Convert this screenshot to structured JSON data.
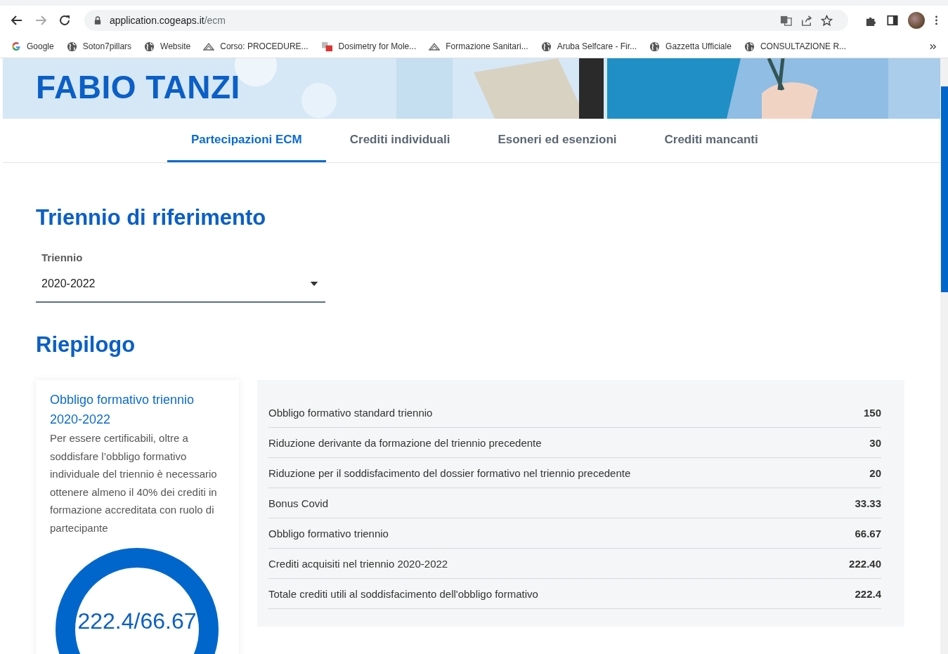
{
  "browser": {
    "url_host": "application.cogeaps.it",
    "url_path": "/ecm",
    "bookmarks": [
      {
        "label": "Google",
        "kind": "google"
      },
      {
        "label": "Soton7pillars",
        "kind": "globe"
      },
      {
        "label": "Website",
        "kind": "globe"
      },
      {
        "label": "Corso: PROCEDURE...",
        "kind": "crest"
      },
      {
        "label": "Dosimetry for Mole...",
        "kind": "squares"
      },
      {
        "label": "Formazione Sanitari...",
        "kind": "crest"
      },
      {
        "label": "Aruba Selfcare - Fir...",
        "kind": "globe"
      },
      {
        "label": "Gazzetta Ufficiale",
        "kind": "globe"
      },
      {
        "label": "CONSULTAZIONE R...",
        "kind": "globe"
      }
    ]
  },
  "hero": {
    "name": "FABIO TANZI"
  },
  "tabs": [
    {
      "label": "Partecipazioni ECM",
      "selected": true
    },
    {
      "label": "Crediti individuali",
      "selected": false
    },
    {
      "label": "Esoneri ed esenzioni",
      "selected": false
    },
    {
      "label": "Crediti mancanti",
      "selected": false
    }
  ],
  "triennio_section": {
    "heading": "Triennio di riferimento",
    "select": {
      "label": "Triennio",
      "value": "2020-2022"
    }
  },
  "riepilogo": {
    "heading": "Riepilogo",
    "card": {
      "title": "Obbligo formativo triennio 2020-2022",
      "text": "Per essere certificabili, oltre a soddisfare l’obbligo formativo individuale del triennio è necessario ottenere almeno il 40% dei crediti in formazione accreditata con ruolo di partecipante",
      "gauge_label": "222.4/66.67"
    },
    "rows": [
      {
        "label": "Obbligo formativo standard triennio",
        "value": "150"
      },
      {
        "label": "Riduzione derivante da formazione del triennio precedente",
        "value": "30"
      },
      {
        "label": "Riduzione per il soddisfacimento del dossier formativo nel triennio precedente",
        "value": "20"
      },
      {
        "label": "Bonus Covid",
        "value": "33.33"
      },
      {
        "label": "Obbligo formativo triennio",
        "value": "66.67"
      },
      {
        "label": "Crediti acquisiti nel triennio 2020-2022",
        "value": "222.40"
      },
      {
        "label": "Totale crediti utili al soddisfacimento dell'obbligo formativo",
        "value": "222.4"
      }
    ]
  }
}
